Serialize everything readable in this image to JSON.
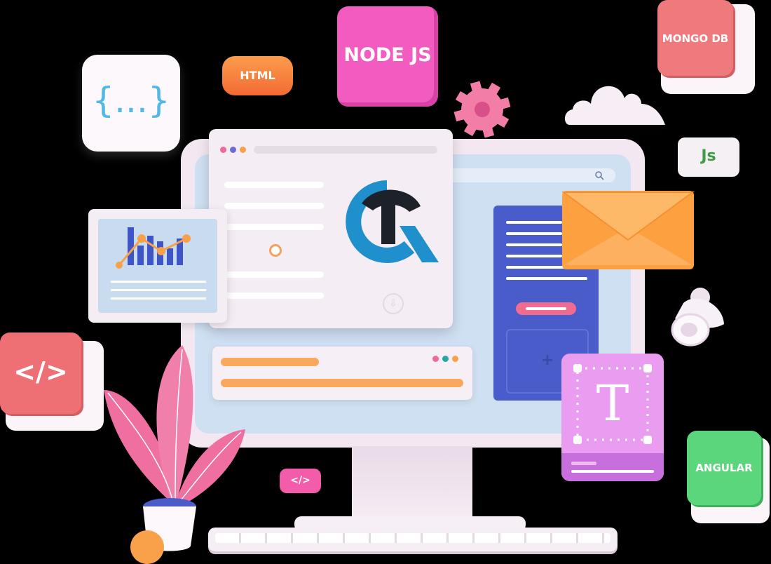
{
  "tiles": {
    "nodejs": "NODE JS",
    "html": "HTML",
    "mongodb": "MONGO DB",
    "js": "Js",
    "angular": "ANGULAR",
    "json_braces": "{...}",
    "code_tag_large": "</>",
    "code_tag_small": "</>",
    "text_icon": "T"
  },
  "colors": {
    "node_pink": "#f25cc0",
    "html_orange": "#f77a3a",
    "mongo_red": "#ef7a7d",
    "js_green": "#3f9c45",
    "angular_green": "#5cd67c",
    "code_red": "#ee6f74",
    "text_tile_purple": "#e99cf0",
    "screen_blue": "#cfe0f3",
    "panel_blue": "#4a5cc9",
    "envelope_orange": "#fca040",
    "logo_blue": "#1f90cc",
    "progress_orange": "#f9a85e"
  }
}
